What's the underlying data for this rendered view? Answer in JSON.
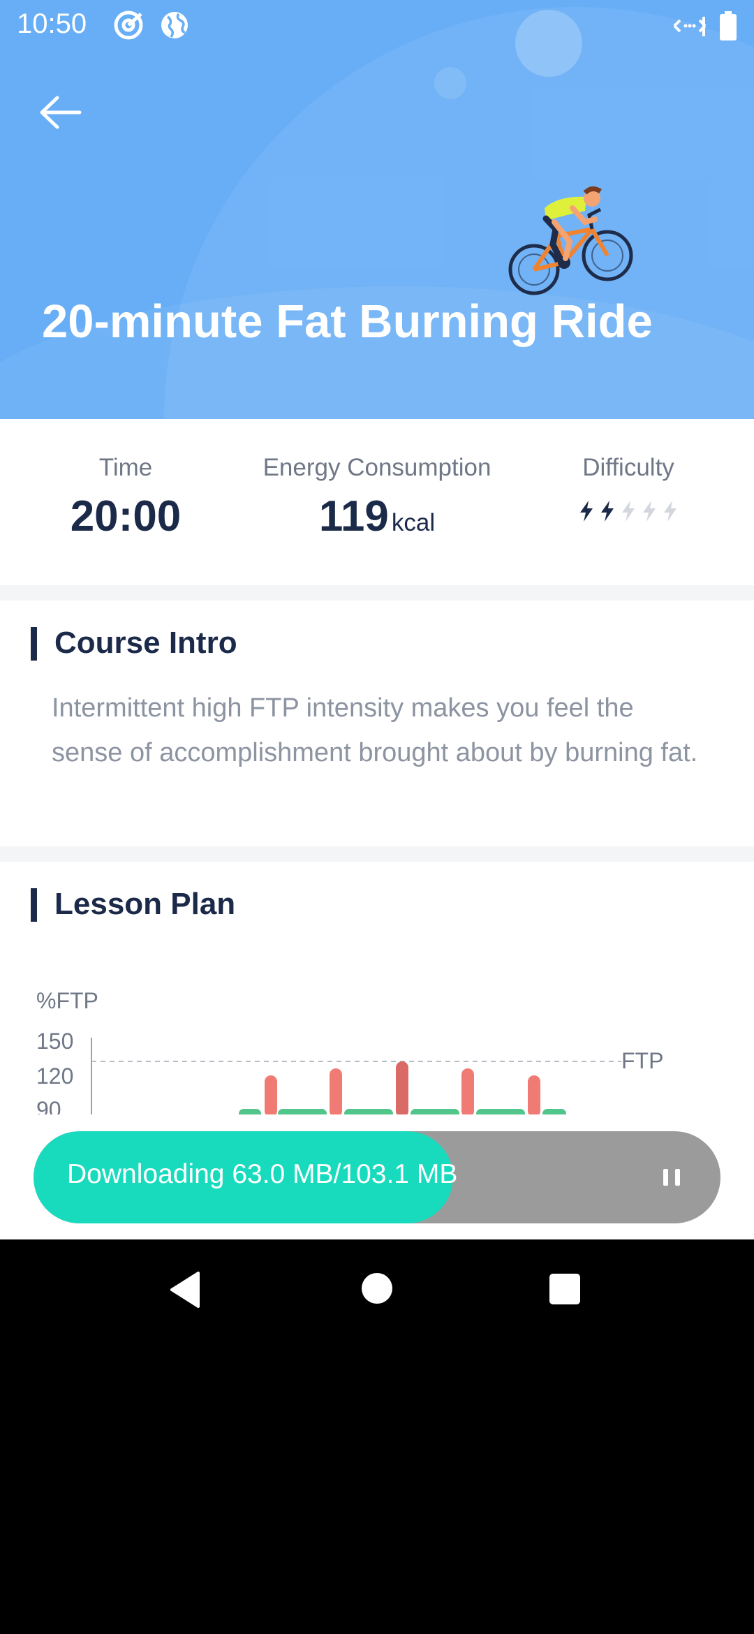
{
  "status_bar": {
    "time": "10:50",
    "icons": [
      "target-icon",
      "globe-icon",
      "data-transfer-icon",
      "battery-icon"
    ]
  },
  "header": {
    "back_icon": "back-arrow-icon",
    "title": "20-minute Fat Burning Ride",
    "illustration": "cyclist-illustration"
  },
  "stats": {
    "time_label": "Time",
    "time_value": "20:00",
    "energy_label": "Energy Consumption",
    "energy_value": "119",
    "energy_unit": "kcal",
    "difficulty_label": "Difficulty",
    "difficulty_level": 2,
    "difficulty_max": 5
  },
  "course_intro": {
    "title": "Course Intro",
    "text": "Intermittent high FTP intensity makes you feel the sense of accomplishment brought about by burning fat."
  },
  "lesson_plan": {
    "title": "Lesson Plan"
  },
  "chart_data": {
    "type": "bar",
    "ylabel": "%FTP",
    "y_ticks": [
      "150",
      "120",
      "90"
    ],
    "reference_line": {
      "label": "FTP",
      "value": 100
    },
    "colors": {
      "rest": "#52c58b",
      "high": "#f07b74",
      "peak": "#d96a66"
    }
  },
  "download": {
    "text": "Downloading 63.0 MB/103.1 MB",
    "progress": 0.611
  },
  "colors": {
    "hero": "#67aef6",
    "accent": "#18dbbe",
    "title_dark": "#1c2a4a"
  },
  "nav": {
    "back": "back-triangle-icon",
    "home": "home-circle-icon",
    "recents": "recents-square-icon"
  }
}
